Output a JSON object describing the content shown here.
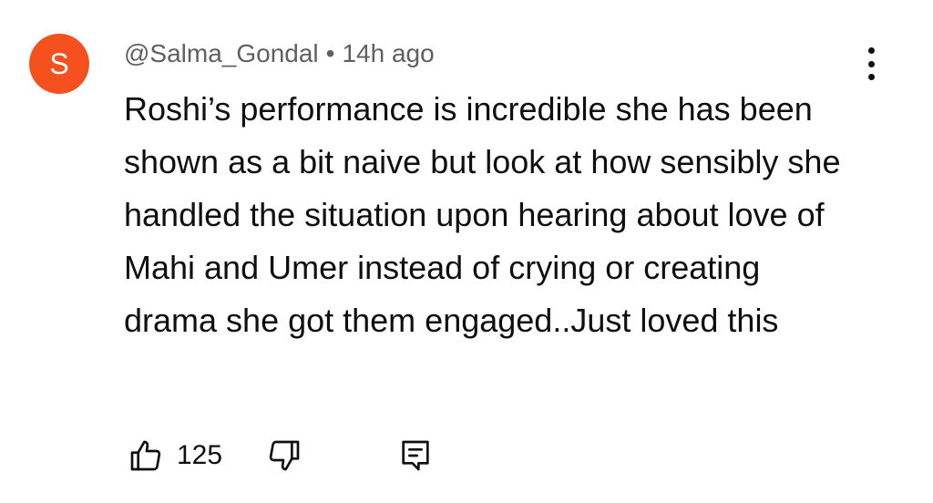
{
  "comment": {
    "avatar_letter": "S",
    "avatar_color": "#f4511e",
    "author": "@Salma_Gondal",
    "separator": "•",
    "time": "14h ago",
    "text": "Roshi’s performance is incredible she has been shown as a bit naive but look at how sensibly she handled the situation upon hearing about love of Mahi and Umer instead of crying or creating drama she got them engaged..Just loved this",
    "like_count": "125",
    "icons": {
      "like": "thumbs-up-icon",
      "dislike": "thumbs-down-icon",
      "reply": "reply-comment-icon",
      "menu": "more-vertical-icon"
    }
  }
}
